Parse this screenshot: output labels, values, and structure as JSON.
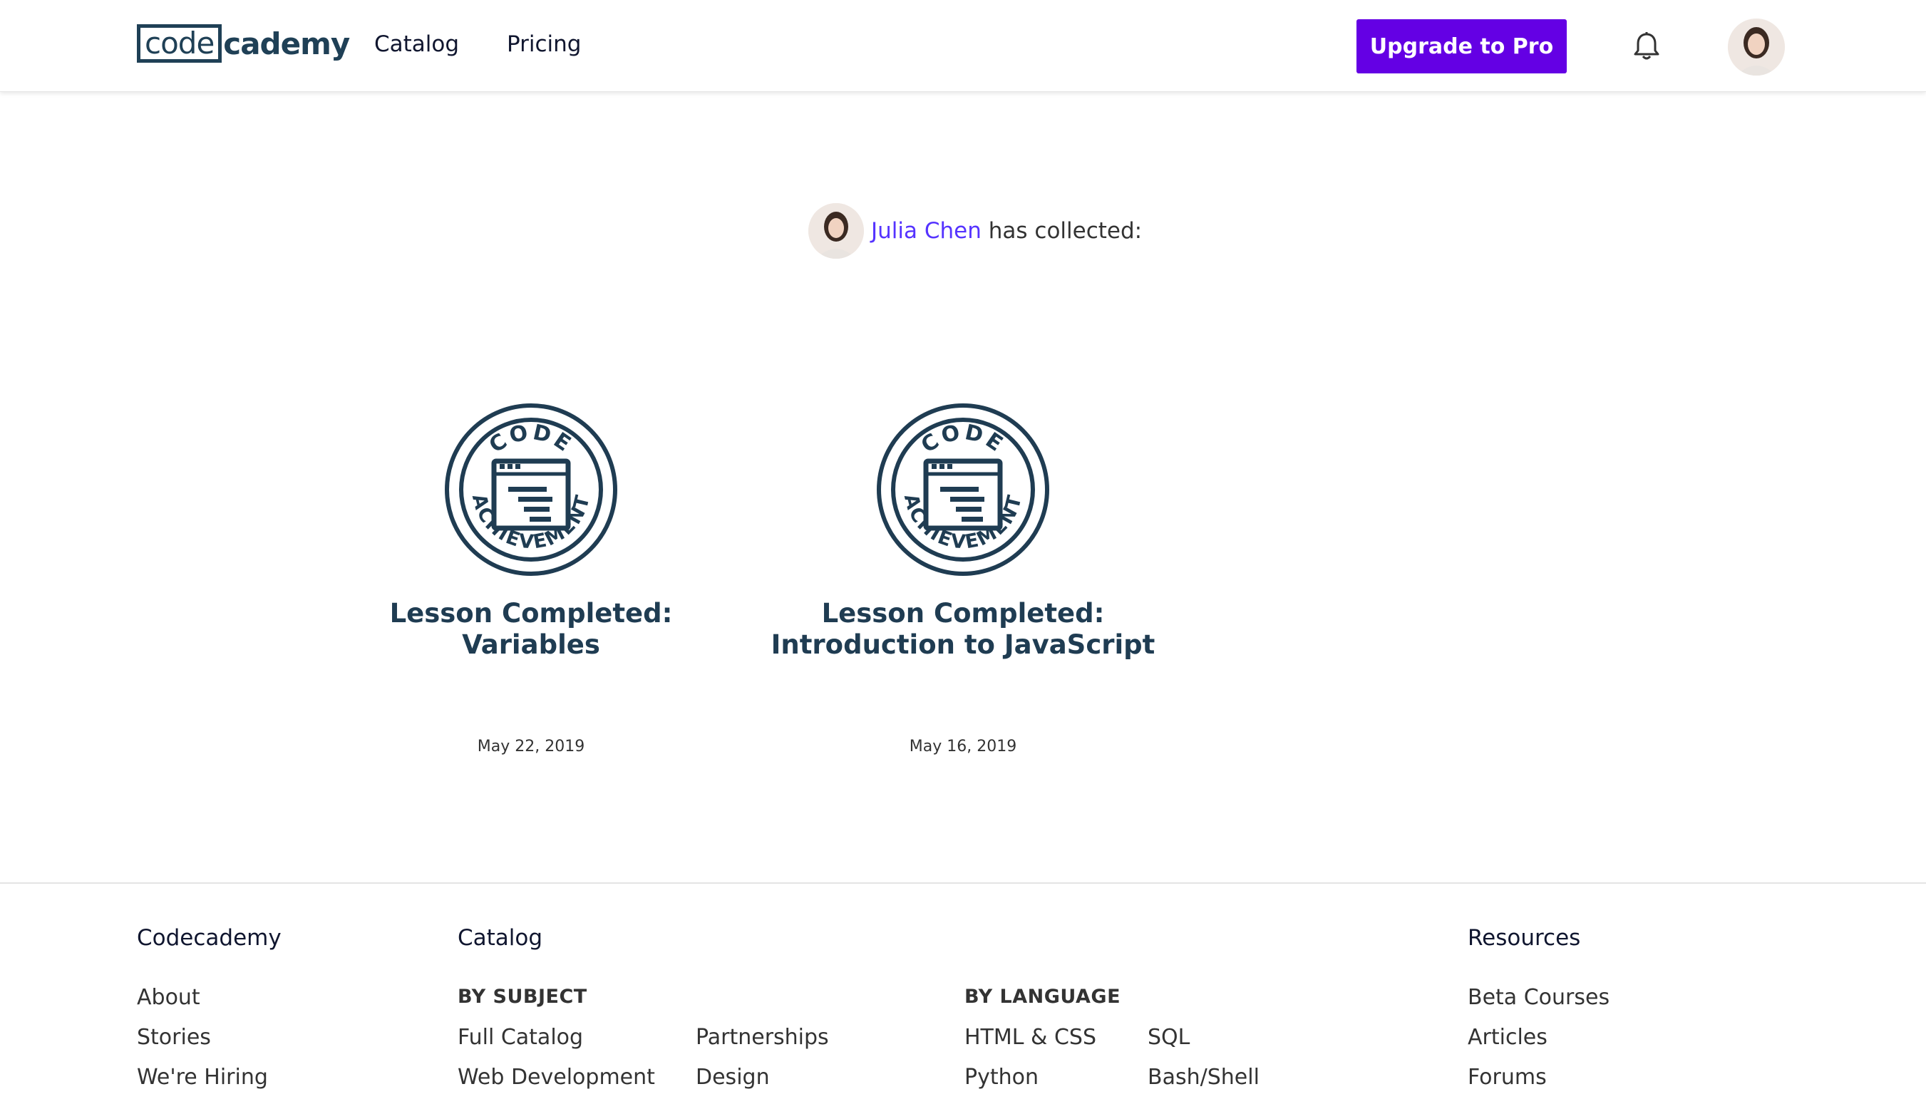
{
  "header": {
    "logo_part1": "code",
    "logo_part2": "cademy",
    "nav": [
      "Catalog",
      "Pricing"
    ],
    "upgrade_label": "Upgrade to Pro",
    "bell_icon": "bell-icon",
    "avatar_icon": "user-avatar"
  },
  "profile": {
    "user_name": "Julia Chen",
    "collected_text": "has collected:"
  },
  "achievements": [
    {
      "badge_top_text": "CODE",
      "badge_bottom_text": "ACHIEVEMENT",
      "title_line1": "Lesson Completed:",
      "title_line2": "Variables",
      "date": "May 22, 2019"
    },
    {
      "badge_top_text": "CODE",
      "badge_bottom_text": "ACHIEVEMENT",
      "title_line1": "Lesson Completed:",
      "title_line2": "Introduction to JavaScript",
      "date": "May 16, 2019"
    }
  ],
  "footer": {
    "col1": {
      "heading": "Codecademy",
      "links": [
        "About",
        "Stories",
        "We're Hiring"
      ]
    },
    "col2": {
      "heading": "Catalog",
      "subject_label": "BY SUBJECT",
      "subject_links_a": [
        "Full Catalog",
        "Web Development"
      ],
      "subject_links_b": [
        "Partnerships",
        "Design"
      ],
      "language_label": "BY LANGUAGE",
      "language_links_a": [
        "HTML & CSS",
        "Python"
      ],
      "language_links_b": [
        "SQL",
        "Bash/Shell"
      ]
    },
    "col3": {
      "heading": "Resources",
      "links": [
        "Beta Courses",
        "Articles",
        "Forums"
      ]
    }
  },
  "colors": {
    "brand_purple": "#6400e4",
    "link_purple": "#5533ff",
    "navy": "#1f3c52"
  }
}
